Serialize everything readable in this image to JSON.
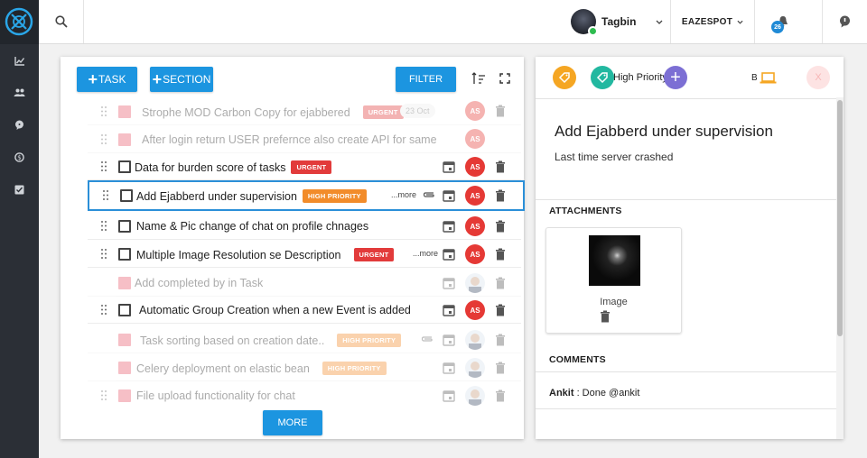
{
  "topbar": {
    "user_name": "Tagbin",
    "org_name": "EAZESPOT",
    "notification_count": "26"
  },
  "toolbar": {
    "task_label": "TASK",
    "section_label": "SECTION",
    "filter_label": "FILTER",
    "more_label": "MORE"
  },
  "tasks": [
    {
      "title": "Strophe MOD Carbon Copy for ejabbered",
      "tag": "URGENT",
      "date": "23 Oct",
      "assignee": "AS"
    },
    {
      "title": "After login return USER prefernce also create API for same",
      "assignee": "AS"
    },
    {
      "title": "Data for burden score of tasks",
      "tag": "URGENT",
      "assignee": "AS"
    },
    {
      "title": "Add Ejabberd under supervision",
      "tag": "HIGH PRIORITY",
      "more": "...more",
      "assignee": "AS"
    },
    {
      "title": "Name & Pic change of chat on profile chnages",
      "assignee": "AS"
    },
    {
      "title": "Multiple Image Resolution se Description",
      "tag": "URGENT",
      "more": "...more",
      "assignee": "AS"
    },
    {
      "title": "Add completed by in Task"
    },
    {
      "title": "Automatic Group Creation when a new Event is added",
      "assignee": "AS"
    },
    {
      "title": "Task sorting based on creation date..",
      "tag": "HIGH PRIORITY"
    },
    {
      "title": "Celery deployment on elastic bean",
      "tag": "HIGH PRIORITY"
    },
    {
      "title": "File upload functionality for chat"
    }
  ],
  "detail": {
    "priority_label": "High Priority",
    "assignee_initial": "B",
    "close_label": "X",
    "title": "Add Ejabberd under supervision",
    "description": "Last time server crashed",
    "attachments_heading": "ATTACHMENTS",
    "attachment_name": "Image",
    "comments_heading": "COMMENTS",
    "comment_author": "Ankit",
    "comment_text": ": Done @ankit"
  },
  "colors": {
    "accent_blue": "#1c95e0",
    "urgent_red": "#e23b3b",
    "high_priority_orange": "#f28c2a",
    "avatar_red": "#e53935"
  }
}
